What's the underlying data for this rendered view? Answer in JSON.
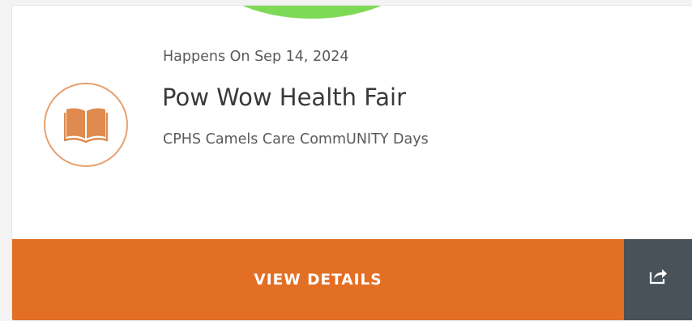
{
  "event": {
    "date_label": "Happens On Sep 14, 2024",
    "title": "Pow Wow Health Fair",
    "subtitle": "CPHS Camels Care CommUNITY Days",
    "icon": "book-icon"
  },
  "actions": {
    "view_details_label": "VIEW DETAILS",
    "share_icon": "share-icon"
  },
  "colors": {
    "accent": "#e36f24",
    "icon_stroke": "#e8a070",
    "icon_fill": "#df8a4e",
    "share_bg": "#4a5259",
    "top_badge": "#7ed957"
  }
}
